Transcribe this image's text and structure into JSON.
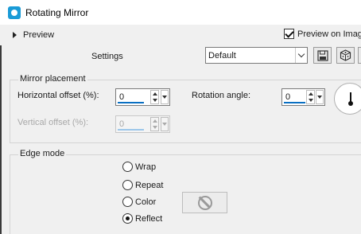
{
  "window": {
    "title": "Rotating Mirror",
    "icon": "app-icon"
  },
  "preview": {
    "label": "Preview",
    "preview_on_image_label": "Preview on Imag",
    "preview_on_image_checked": true
  },
  "settings": {
    "label": "Settings",
    "preset_value": "Default",
    "save_icon": "save-icon",
    "random_icon": "dice-icon"
  },
  "mirror_placement": {
    "title": "Mirror placement",
    "horizontal_offset_label": "Horizontal offset (%):",
    "horizontal_offset_value": "0",
    "vertical_offset_label": "Vertical offset (%):",
    "vertical_offset_value": "0",
    "rotation_angle_label": "Rotation angle:",
    "rotation_angle_value": "0"
  },
  "edge_mode": {
    "title": "Edge mode",
    "options": [
      "Wrap",
      "Repeat",
      "Color",
      "Reflect"
    ],
    "selected": "Reflect",
    "color_icon": "no-color-icon"
  }
}
